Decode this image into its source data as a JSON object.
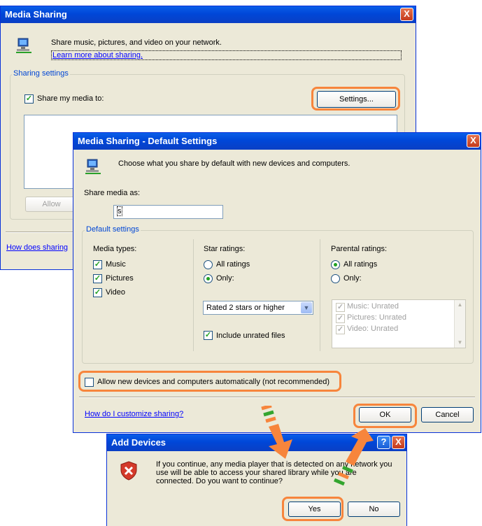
{
  "main_dialog": {
    "title": "Media Sharing",
    "close_label": "X",
    "intro_text": "Share music, pictures, and video on your network.",
    "learn_more_link": "Learn more about sharing.",
    "group_label": "Sharing settings",
    "share_checkbox_label": "Share my media to:",
    "settings_button": "Settings...",
    "allow_button": "Allow",
    "how_link": "How does sharing"
  },
  "defaults_dialog": {
    "title": "Media Sharing - Default Settings",
    "close_label": "X",
    "intro_text": "Choose what you share by default with new devices and computers.",
    "share_as_label": "Share media as:",
    "share_as_value": "s",
    "group_label": "Default settings",
    "media_types": {
      "label": "Media types:",
      "items": [
        {
          "label": "Music",
          "checked": true
        },
        {
          "label": "Pictures",
          "checked": true
        },
        {
          "label": "Video",
          "checked": true
        }
      ]
    },
    "star_ratings": {
      "label": "Star ratings:",
      "all_label": "All ratings",
      "only_label": "Only:",
      "selected": "only",
      "dropdown_value": "Rated 2 stars or higher",
      "include_unrated_label": "Include unrated files",
      "include_unrated_checked": true
    },
    "parental_ratings": {
      "label": "Parental ratings:",
      "all_label": "All ratings",
      "only_label": "Only:",
      "selected": "all",
      "list_items": [
        "Music: Unrated",
        "Pictures: Unrated",
        "Video: Unrated"
      ]
    },
    "allow_auto_label": "Allow new devices and computers automatically (not recommended)",
    "allow_auto_checked": false,
    "customize_link": "How do I customize sharing?",
    "ok_button": "OK",
    "cancel_button": "Cancel"
  },
  "add_devices_dialog": {
    "title": "Add Devices",
    "help_label": "?",
    "close_label": "X",
    "message": "If you continue, any media player that is detected on any network you use will be able to access your shared library while you are connected. Do you want to continue?",
    "yes_button": "Yes",
    "no_button": "No"
  },
  "colors": {
    "highlight": "#f7853c",
    "arrow_green": "#33a52f",
    "titlebar": "#0047d8"
  },
  "icons": {
    "network_share": "network-computer-icon",
    "shield": "security-shield-icon",
    "arrows": "callout-arrow-icon"
  }
}
